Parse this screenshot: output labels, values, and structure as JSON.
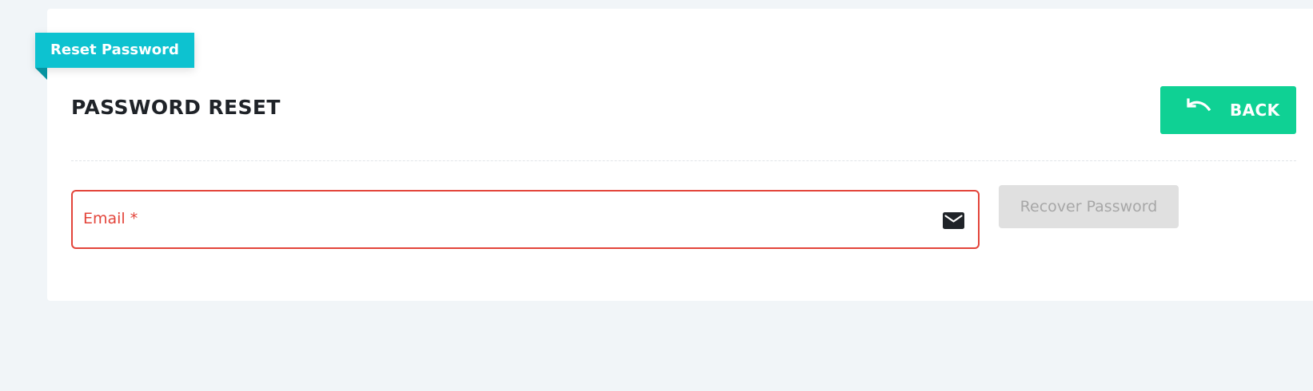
{
  "ribbon": {
    "label": "Reset Password"
  },
  "header": {
    "title": "PASSWORD RESET",
    "back_label": "BACK"
  },
  "form": {
    "email_label": "Email *",
    "email_value": "",
    "recover_label": "Recover Password"
  },
  "colors": {
    "accent_teal": "#0dc2d0",
    "back_button_green": "#0fd194",
    "error_red": "#e3443a",
    "disabled_gray": "#e0e0e0",
    "background": "#f1f5f8"
  },
  "icons": {
    "back": "undo-arrow-icon",
    "email": "envelope-icon"
  }
}
